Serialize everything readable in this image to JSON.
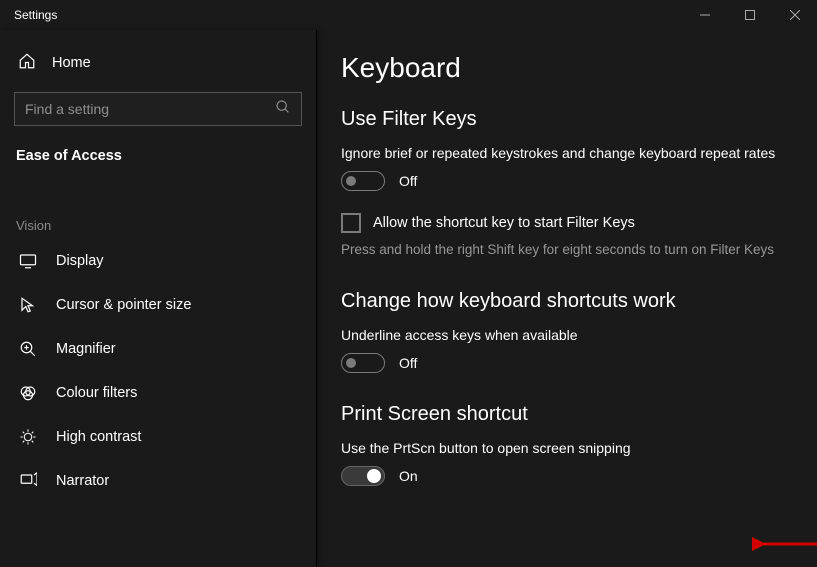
{
  "window": {
    "title": "Settings"
  },
  "sidebar": {
    "home": "Home",
    "search_placeholder": "Find a setting",
    "category": "Ease of Access",
    "group_label": "Vision",
    "items": [
      {
        "label": "Display"
      },
      {
        "label": "Cursor & pointer size"
      },
      {
        "label": "Magnifier"
      },
      {
        "label": "Colour filters"
      },
      {
        "label": "High contrast"
      },
      {
        "label": "Narrator"
      }
    ]
  },
  "content": {
    "page_title": "Keyboard",
    "filter_keys": {
      "heading": "Use Filter Keys",
      "description": "Ignore brief or repeated keystrokes and change keyboard repeat rates",
      "toggle_state": "Off",
      "checkbox_label": "Allow the shortcut key to start Filter Keys",
      "checkbox_desc": "Press and hold the right Shift key for eight seconds to turn on Filter Keys"
    },
    "shortcuts": {
      "heading": "Change how keyboard shortcuts work",
      "description": "Underline access keys when available",
      "toggle_state": "Off"
    },
    "print_screen": {
      "heading": "Print Screen shortcut",
      "description": "Use the PrtScn button to open screen snipping",
      "toggle_state": "On"
    }
  }
}
